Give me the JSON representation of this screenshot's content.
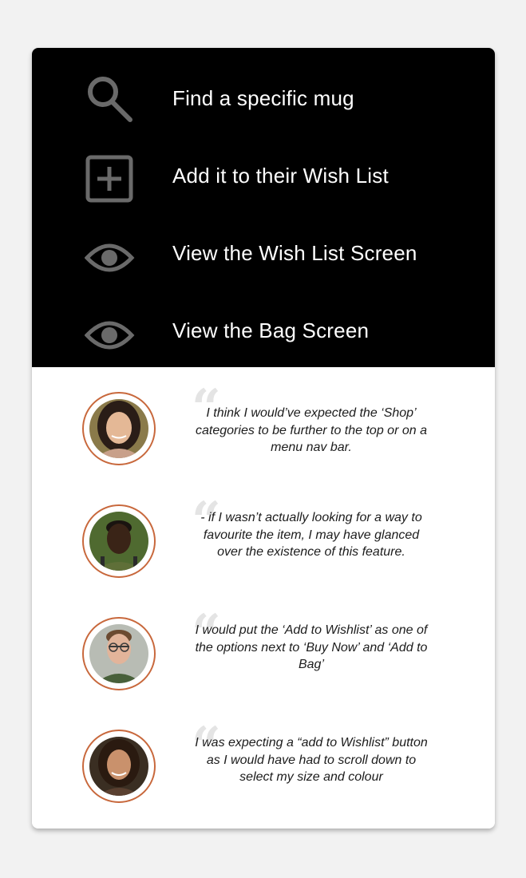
{
  "tasks": [
    {
      "icon": "search-icon",
      "label": "Find a specific mug"
    },
    {
      "icon": "add-box-icon",
      "label": "Add it to their Wish List"
    },
    {
      "icon": "eye-icon",
      "label": "View the Wish List Screen"
    },
    {
      "icon": "eye-icon",
      "label": "View the Bag Screen"
    }
  ],
  "quote_mark": "“",
  "quotes": [
    {
      "avatar": "avatar-icon",
      "text": "I think I would’ve expected the ‘Shop’ categories to be further to the top or on a menu nav bar."
    },
    {
      "avatar": "avatar-icon",
      "text": "- if I wasn’t actually looking for a way to favourite the item, I may have glanced over the existence of this feature."
    },
    {
      "avatar": "avatar-icon",
      "text": "I would put the ‘Add to Wishlist’ as one of the options next to ‘Buy Now’ and ‘Add to Bag’"
    },
    {
      "avatar": "avatar-icon",
      "text": "I was expecting a “add to Wishlist” button as I would have had to scroll down to select my size and colour"
    }
  ],
  "colors": {
    "page_background": "#f2f2f2",
    "task_panel_background": "#000000",
    "task_text": "#ffffff",
    "icon_gray": "#6a6a6a",
    "avatar_ring": "#c8683c",
    "quote_mark": "#e4e4e4",
    "quote_text": "#1c1c1c"
  }
}
